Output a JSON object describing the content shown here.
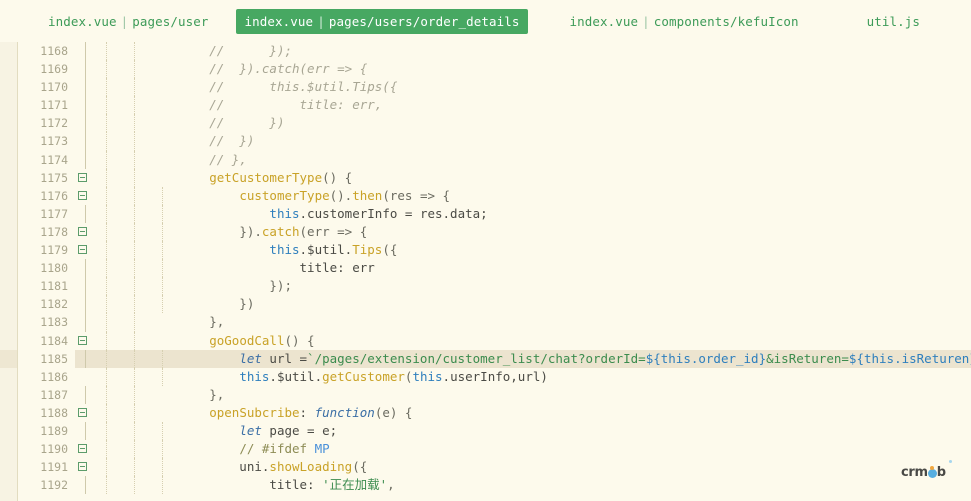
{
  "window": {
    "title": "Code editor — pages/users/order_details",
    "background": "#fdfaec",
    "accent": "#47a862"
  },
  "tabbar": {
    "tabs": [
      {
        "file": "index.vue",
        "sep": "|",
        "path": "pages/user",
        "active": false
      },
      {
        "file": "index.vue",
        "sep": "|",
        "path": "pages/users/order_details",
        "active": true
      },
      {
        "file": "index.vue",
        "sep": "|",
        "path": "components/kefuIcon",
        "active": false
      },
      {
        "file": "util.js",
        "sep": "",
        "path": "",
        "active": false
      }
    ]
  },
  "editor": {
    "first_line": 1168,
    "last_line": 1192,
    "highlighted_line": 1185,
    "lines": [
      {
        "n": 1168,
        "fold": false,
        "gutter": true,
        "guides": 2,
        "tokens": [
          {
            "t": "        ",
            "c": "plain"
          },
          {
            "t": "//      });",
            "c": "cm"
          }
        ]
      },
      {
        "n": 1169,
        "fold": false,
        "gutter": true,
        "guides": 2,
        "tokens": [
          {
            "t": "        ",
            "c": "plain"
          },
          {
            "t": "//  }).catch(err => {",
            "c": "cm"
          }
        ]
      },
      {
        "n": 1170,
        "fold": false,
        "gutter": true,
        "guides": 2,
        "tokens": [
          {
            "t": "        ",
            "c": "plain"
          },
          {
            "t": "//      this.$util.Tips({",
            "c": "cm"
          }
        ]
      },
      {
        "n": 1171,
        "fold": false,
        "gutter": true,
        "guides": 2,
        "tokens": [
          {
            "t": "        ",
            "c": "plain"
          },
          {
            "t": "//          title: err,",
            "c": "cm"
          }
        ]
      },
      {
        "n": 1172,
        "fold": false,
        "gutter": true,
        "guides": 2,
        "tokens": [
          {
            "t": "        ",
            "c": "plain"
          },
          {
            "t": "//      })",
            "c": "cm"
          }
        ]
      },
      {
        "n": 1173,
        "fold": false,
        "gutter": true,
        "guides": 2,
        "tokens": [
          {
            "t": "        ",
            "c": "plain"
          },
          {
            "t": "//  })",
            "c": "cm"
          }
        ]
      },
      {
        "n": 1174,
        "fold": false,
        "gutter": true,
        "guides": 2,
        "tokens": [
          {
            "t": "        ",
            "c": "plain"
          },
          {
            "t": "// },",
            "c": "cm"
          }
        ]
      },
      {
        "n": 1175,
        "fold": true,
        "gutter": false,
        "guides": 2,
        "tokens": [
          {
            "t": "        ",
            "c": "plain"
          },
          {
            "t": "getCustomerType",
            "c": "fn"
          },
          {
            "t": "() {",
            "c": "punc"
          }
        ]
      },
      {
        "n": 1176,
        "fold": true,
        "gutter": false,
        "guides": 3,
        "tokens": [
          {
            "t": "            ",
            "c": "plain"
          },
          {
            "t": "customerType",
            "c": "fn"
          },
          {
            "t": "().",
            "c": "punc"
          },
          {
            "t": "then",
            "c": "fn"
          },
          {
            "t": "(res => {",
            "c": "punc"
          }
        ]
      },
      {
        "n": 1177,
        "fold": false,
        "gutter": true,
        "guides": 3,
        "tokens": [
          {
            "t": "                ",
            "c": "plain"
          },
          {
            "t": "this",
            "c": "th"
          },
          {
            "t": ".customerInfo = res.data;",
            "c": "plain"
          }
        ]
      },
      {
        "n": 1178,
        "fold": true,
        "gutter": false,
        "guides": 3,
        "tokens": [
          {
            "t": "            ",
            "c": "plain"
          },
          {
            "t": "}).",
            "c": "punc"
          },
          {
            "t": "catch",
            "c": "fn"
          },
          {
            "t": "(err => {",
            "c": "punc"
          }
        ]
      },
      {
        "n": 1179,
        "fold": true,
        "gutter": false,
        "guides": 3,
        "tokens": [
          {
            "t": "                ",
            "c": "plain"
          },
          {
            "t": "this",
            "c": "th"
          },
          {
            "t": ".$util.",
            "c": "plain"
          },
          {
            "t": "Tips",
            "c": "fn"
          },
          {
            "t": "({",
            "c": "punc"
          }
        ]
      },
      {
        "n": 1180,
        "fold": false,
        "gutter": true,
        "guides": 3,
        "tokens": [
          {
            "t": "                    title: err",
            "c": "plain"
          }
        ]
      },
      {
        "n": 1181,
        "fold": false,
        "gutter": true,
        "guides": 3,
        "tokens": [
          {
            "t": "                });",
            "c": "punc"
          }
        ]
      },
      {
        "n": 1182,
        "fold": false,
        "gutter": true,
        "guides": 3,
        "tokens": [
          {
            "t": "            })",
            "c": "punc"
          }
        ]
      },
      {
        "n": 1183,
        "fold": false,
        "gutter": true,
        "guides": 2,
        "tokens": [
          {
            "t": "        },",
            "c": "punc"
          }
        ]
      },
      {
        "n": 1184,
        "fold": true,
        "gutter": false,
        "guides": 2,
        "tokens": [
          {
            "t": "        ",
            "c": "plain"
          },
          {
            "t": "goGoodCall",
            "c": "fn"
          },
          {
            "t": "() {",
            "c": "punc"
          }
        ]
      },
      {
        "n": 1185,
        "fold": false,
        "gutter": true,
        "guides": 3,
        "tokens": [
          {
            "t": "            ",
            "c": "plain"
          },
          {
            "t": "let",
            "c": "kw"
          },
          {
            "t": " url =",
            "c": "plain"
          },
          {
            "t": "`/pages/extension/customer_list/chat?orderId=",
            "c": "str"
          },
          {
            "t": "${this.order_id}",
            "c": "th"
          },
          {
            "t": "&isReturen=",
            "c": "str"
          },
          {
            "t": "${this.isReturen}",
            "c": "th"
          },
          {
            "t": "`",
            "c": "str"
          }
        ]
      },
      {
        "n": 1186,
        "fold": false,
        "gutter": false,
        "guides": 3,
        "tokens": [
          {
            "t": "            ",
            "c": "plain"
          },
          {
            "t": "this",
            "c": "th"
          },
          {
            "t": ".$util.",
            "c": "plain"
          },
          {
            "t": "getCustomer",
            "c": "fn"
          },
          {
            "t": "(",
            "c": "punc"
          },
          {
            "t": "this",
            "c": "th"
          },
          {
            "t": ".userInfo,url)",
            "c": "plain"
          }
        ]
      },
      {
        "n": 1187,
        "fold": false,
        "gutter": true,
        "guides": 2,
        "tokens": [
          {
            "t": "        },",
            "c": "punc"
          }
        ]
      },
      {
        "n": 1188,
        "fold": true,
        "gutter": false,
        "guides": 2,
        "tokens": [
          {
            "t": "        ",
            "c": "plain"
          },
          {
            "t": "openSubcribe",
            "c": "fn"
          },
          {
            "t": ": ",
            "c": "plain"
          },
          {
            "t": "function",
            "c": "kw"
          },
          {
            "t": "(e) {",
            "c": "punc"
          }
        ]
      },
      {
        "n": 1189,
        "fold": false,
        "gutter": true,
        "guides": 3,
        "tokens": [
          {
            "t": "            ",
            "c": "plain"
          },
          {
            "t": "let",
            "c": "kw"
          },
          {
            "t": " page = e;",
            "c": "plain"
          }
        ]
      },
      {
        "n": 1190,
        "fold": true,
        "gutter": false,
        "guides": 3,
        "tokens": [
          {
            "t": "            ",
            "c": "plain"
          },
          {
            "t": "// #ifdef ",
            "c": "cm2"
          },
          {
            "t": "MP",
            "c": "mp"
          }
        ]
      },
      {
        "n": 1191,
        "fold": true,
        "gutter": false,
        "guides": 3,
        "tokens": [
          {
            "t": "            uni.",
            "c": "plain"
          },
          {
            "t": "showLoading",
            "c": "fn"
          },
          {
            "t": "({",
            "c": "punc"
          }
        ]
      },
      {
        "n": 1192,
        "fold": false,
        "gutter": true,
        "guides": 3,
        "tokens": [
          {
            "t": "                title: ",
            "c": "plain"
          },
          {
            "t": "'正在加载'",
            "c": "str"
          },
          {
            "t": ",",
            "c": "punc"
          }
        ]
      }
    ]
  },
  "watermark": {
    "text_left": "crm",
    "text_right": "b",
    "brand": "crmeb",
    "dot_color": "#4aa8e0",
    "accent_color": "#f0a030"
  }
}
